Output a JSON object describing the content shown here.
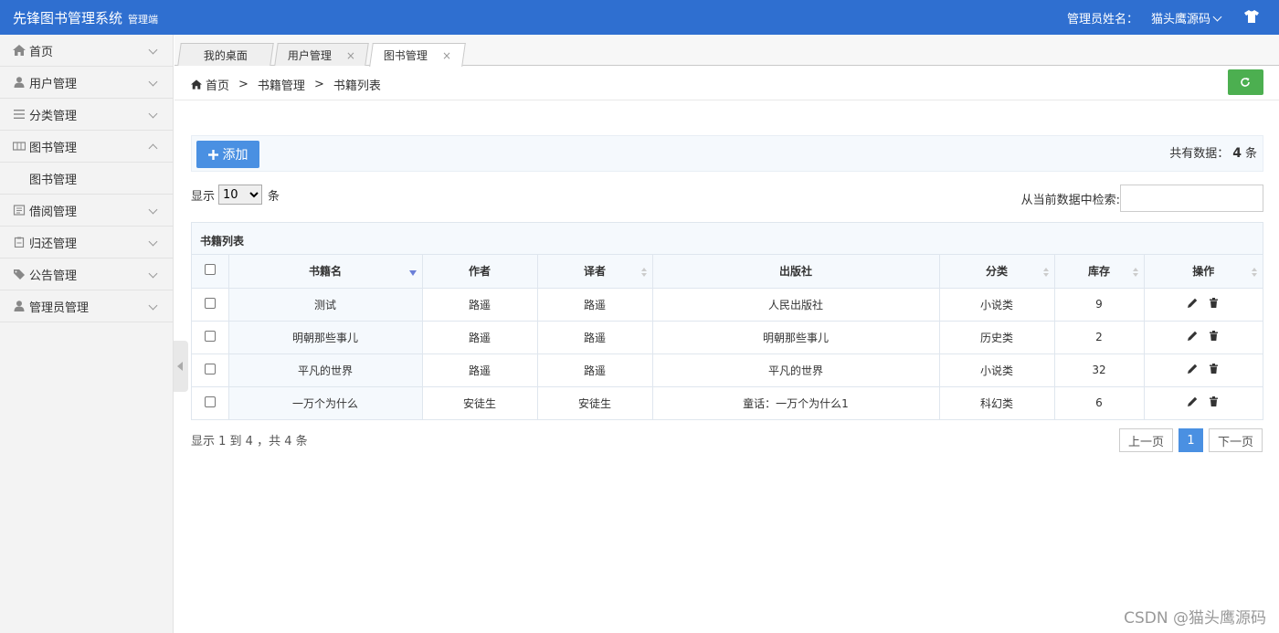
{
  "topbar": {
    "title": "先锋图书管理系统",
    "subtitle": "管理端",
    "admin_label": "管理员姓名：",
    "admin_name": "猫头鹰源码",
    "shirt_icon": "shirt-icon"
  },
  "sidebar": {
    "items": [
      {
        "label": "首页",
        "icon": "home-icon"
      },
      {
        "label": "用户管理",
        "icon": "user-icon"
      },
      {
        "label": "分类管理",
        "icon": "list-icon"
      },
      {
        "label": "图书管理",
        "icon": "book-icon",
        "expanded": true,
        "sub": [
          "图书管理"
        ]
      },
      {
        "label": "借阅管理",
        "icon": "borrow-icon"
      },
      {
        "label": "归还管理",
        "icon": "return-icon"
      },
      {
        "label": "公告管理",
        "icon": "tag-icon"
      },
      {
        "label": "管理员管理",
        "icon": "admin-icon"
      }
    ]
  },
  "tabs": [
    {
      "label": "我的桌面",
      "closable": false
    },
    {
      "label": "用户管理",
      "closable": true
    },
    {
      "label": "图书管理",
      "closable": true,
      "active": true
    }
  ],
  "tab_close": "×",
  "breadcrumb": {
    "home": "首页",
    "level1": "书籍管理",
    "level2": "书籍列表",
    "sep": ">"
  },
  "toolbar": {
    "add_label": "添加",
    "total_prefix": "共有数据：",
    "total_count": "4",
    "total_suffix": "条"
  },
  "length": {
    "prefix": "显示",
    "value": "10",
    "suffix": "条"
  },
  "search": {
    "label": "从当前数据中检索:",
    "value": ""
  },
  "table": {
    "caption": "书籍列表",
    "headers": [
      "书籍名",
      "作者",
      "译者",
      "出版社",
      "分类",
      "库存",
      "操作"
    ],
    "rows": [
      [
        "测试",
        "路遥",
        "路遥",
        "人民出版社",
        "小说类",
        "9"
      ],
      [
        "明朝那些事儿",
        "路遥",
        "路遥",
        "明朝那些事儿",
        "历史类",
        "2"
      ],
      [
        "平凡的世界",
        "路遥",
        "路遥",
        "平凡的世界",
        "小说类",
        "32"
      ],
      [
        "一万个为什么",
        "安徒生",
        "安徒生",
        "童话：一万个为什么1",
        "科幻类",
        "6"
      ]
    ]
  },
  "info": "显示 1 到 4 ，共 4 条",
  "pager": {
    "prev": "上一页",
    "current": "1",
    "next": "下一页"
  },
  "watermark": "CSDN @猫头鹰源码",
  "colors": {
    "topbar": "#2f6fd0",
    "primary": "#4a90e2",
    "refresh": "#4caf50"
  }
}
